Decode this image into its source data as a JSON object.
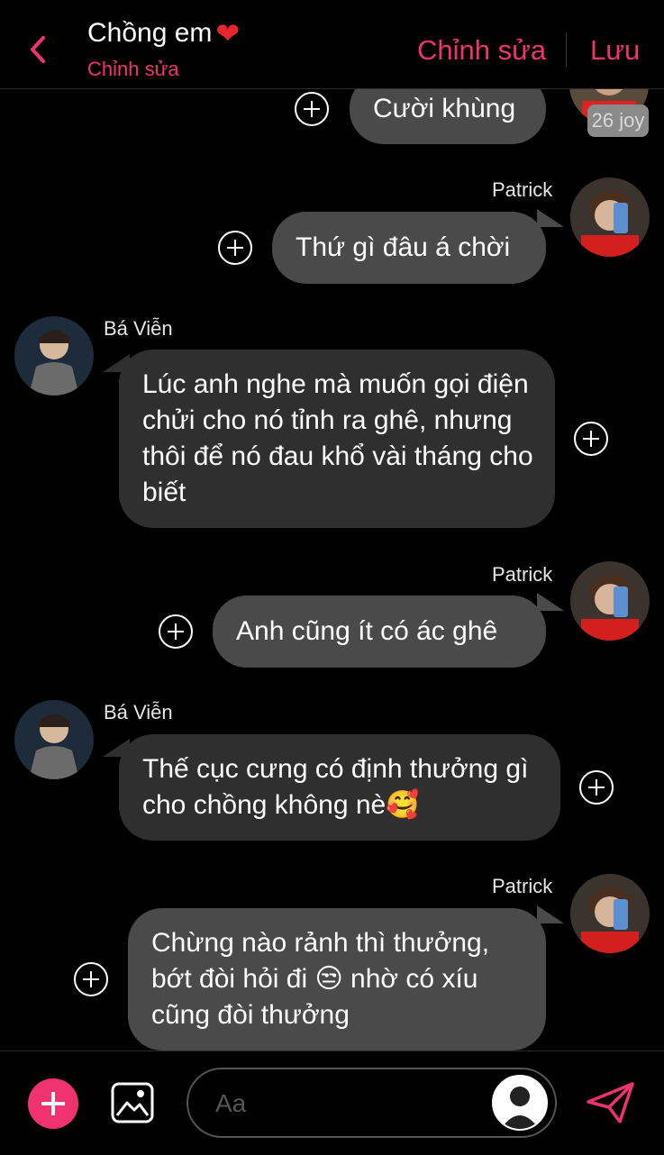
{
  "colors": {
    "accent": "#f0336f",
    "bg": "#000000",
    "bubble_right": "#4a4a4a",
    "bubble_left": "#2f2f2f"
  },
  "header": {
    "title": "Chồng em",
    "title_emoji": "❤️",
    "subtitle": "Chỉnh sửa",
    "edit_label": "Chỉnh sửa",
    "save_label": "Lưu"
  },
  "messages": [
    {
      "side": "right",
      "text": "Cười khùng",
      "badge": "26 joy"
    },
    {
      "side": "right",
      "sender": "Patrick",
      "text": "Thứ gì đâu á chời"
    },
    {
      "side": "left",
      "sender": "Bá Viễn",
      "text": "Lúc anh nghe mà muốn gọi điện chửi cho nó tỉnh ra ghê, nhưng thôi để nó đau khổ vài tháng cho biết"
    },
    {
      "side": "right",
      "sender": "Patrick",
      "text": "Anh cũng ít có ác ghê"
    },
    {
      "side": "left",
      "sender": "Bá Viễn",
      "text": "Thế cục cưng có định thưởng gì cho chồng không nè🥰"
    },
    {
      "side": "right",
      "sender": "Patrick",
      "text": "Chừng nào rảnh thì thưởng, bớt đòi hỏi đi 😒 nhờ có xíu cũng đòi thưởng"
    }
  ],
  "composer": {
    "placeholder": "Aa"
  }
}
